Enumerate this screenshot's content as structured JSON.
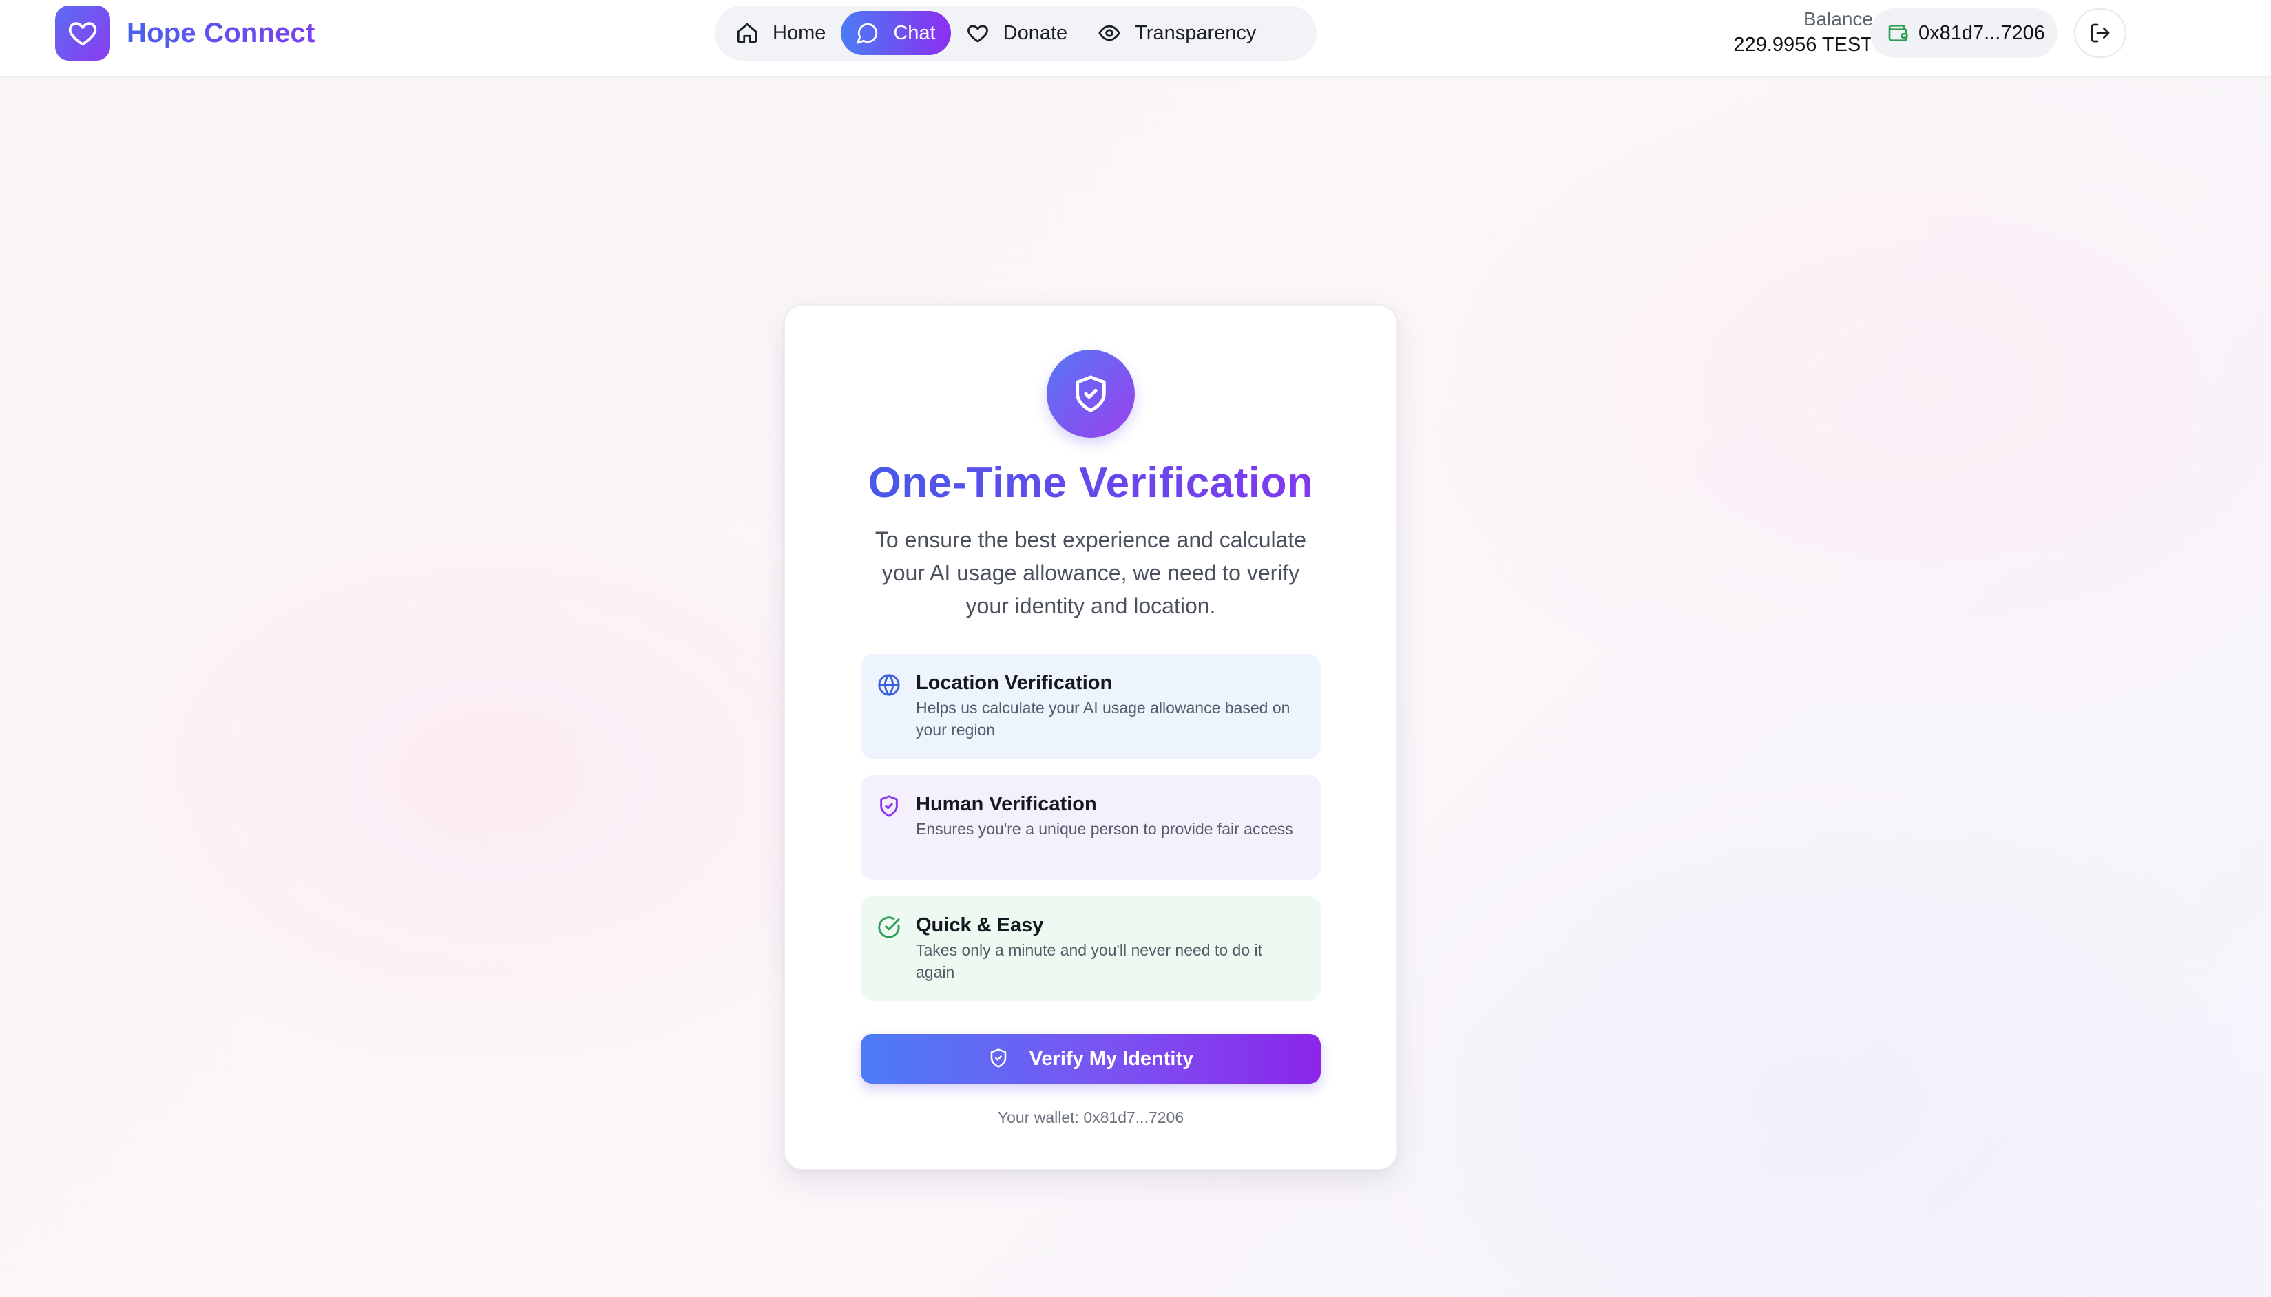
{
  "app": {
    "name": "Hope Connect",
    "logo_icon": "heart-icon",
    "brand_gradient": [
      "#5b6cf3",
      "#8b3cf0"
    ]
  },
  "nav": {
    "items": [
      {
        "label": "Home",
        "icon": "home-icon",
        "active": false
      },
      {
        "label": "Chat",
        "icon": "chat-bubble-icon",
        "active": true
      },
      {
        "label": "Donate",
        "icon": "heart-icon",
        "active": false
      },
      {
        "label": "Transparency",
        "icon": "eye-icon",
        "active": false
      }
    ]
  },
  "account": {
    "balance_label": "Balance",
    "balance_value": "229.9956 TEST",
    "wallet_address": "0x81d7...7206",
    "wallet_icon": "wallet-icon",
    "logout_icon": "logout-icon"
  },
  "verification": {
    "icon": "shield-check-icon",
    "title": "One-Time Verification",
    "subtitle": "To ensure the best experience and calculate your AI usage allowance, we need to verify your identity and location.",
    "features": [
      {
        "icon": "globe-icon",
        "title": "Location Verification",
        "description": "Helps us calculate your AI usage allowance based on your region",
        "accent": "#3b5fd9"
      },
      {
        "icon": "shield-check-icon",
        "title": "Human Verification",
        "description": "Ensures you're a unique person to provide fair access",
        "accent": "#8a34ef"
      },
      {
        "icon": "check-circle-icon",
        "title": "Quick & Easy",
        "description": "Takes only a minute and you'll never need to do it again",
        "accent": "#2f9e55"
      }
    ],
    "button_label": "Verify My Identity",
    "wallet_note": "Your wallet: 0x81d7...7206"
  }
}
